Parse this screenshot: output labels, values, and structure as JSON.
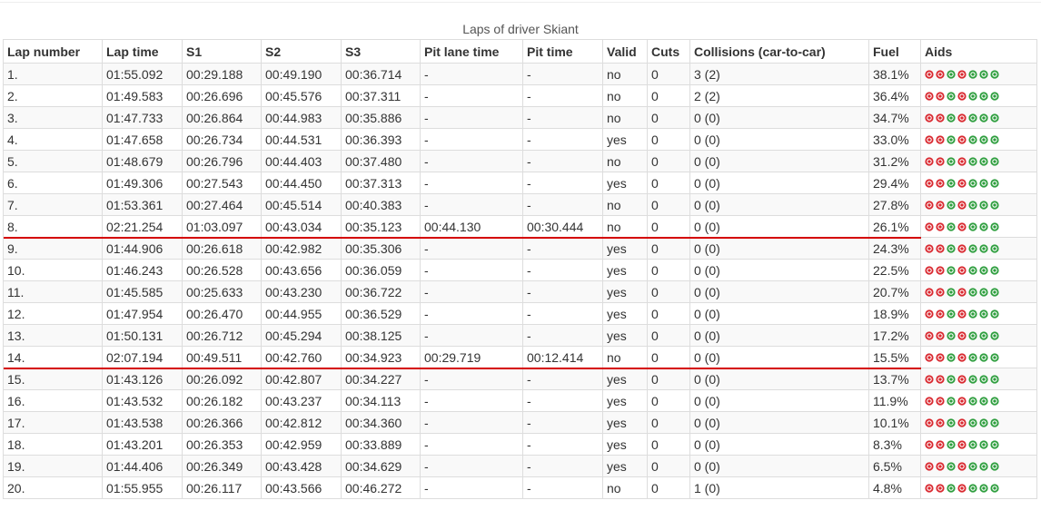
{
  "title": "Laps of driver Skiant",
  "columns": [
    "Lap number",
    "Lap time",
    "S1",
    "S2",
    "S3",
    "Pit lane time",
    "Pit time",
    "Valid",
    "Cuts",
    "Collisions (car-to-car)",
    "Fuel",
    "Aids"
  ],
  "aid_icons": [
    {
      "name": "abs-aid-icon",
      "color": "#d9282f"
    },
    {
      "name": "traction-control-aid-icon",
      "color": "#d9282f"
    },
    {
      "name": "stability-control-aid-icon",
      "color": "#2e9e3e"
    },
    {
      "name": "auto-clutch-aid-icon",
      "color": "#d9282f"
    },
    {
      "name": "auto-gear-aid-icon",
      "color": "#2e9e3e"
    },
    {
      "name": "ideal-line-aid-icon",
      "color": "#2e9e3e"
    },
    {
      "name": "auto-blip-aid-icon",
      "color": "#2e9e3e"
    }
  ],
  "rows": [
    [
      "1.",
      "01:55.092",
      "00:29.188",
      "00:49.190",
      "00:36.714",
      "-",
      "-",
      "no",
      "0",
      "3 (2)",
      "38.1%"
    ],
    [
      "2.",
      "01:49.583",
      "00:26.696",
      "00:45.576",
      "00:37.311",
      "-",
      "-",
      "no",
      "0",
      "2 (2)",
      "36.4%"
    ],
    [
      "3.",
      "01:47.733",
      "00:26.864",
      "00:44.983",
      "00:35.886",
      "-",
      "-",
      "no",
      "0",
      "0 (0)",
      "34.7%"
    ],
    [
      "4.",
      "01:47.658",
      "00:26.734",
      "00:44.531",
      "00:36.393",
      "-",
      "-",
      "yes",
      "0",
      "0 (0)",
      "33.0%"
    ],
    [
      "5.",
      "01:48.679",
      "00:26.796",
      "00:44.403",
      "00:37.480",
      "-",
      "-",
      "no",
      "0",
      "0 (0)",
      "31.2%"
    ],
    [
      "6.",
      "01:49.306",
      "00:27.543",
      "00:44.450",
      "00:37.313",
      "-",
      "-",
      "yes",
      "0",
      "0 (0)",
      "29.4%"
    ],
    [
      "7.",
      "01:53.361",
      "00:27.464",
      "00:45.514",
      "00:40.383",
      "-",
      "-",
      "no",
      "0",
      "0 (0)",
      "27.8%"
    ],
    [
      "8.",
      "02:21.254",
      "01:03.097",
      "00:43.034",
      "00:35.123",
      "00:44.130",
      "00:30.444",
      "no",
      "0",
      "0 (0)",
      "26.1%"
    ],
    [
      "9.",
      "01:44.906",
      "00:26.618",
      "00:42.982",
      "00:35.306",
      "-",
      "-",
      "yes",
      "0",
      "0 (0)",
      "24.3%"
    ],
    [
      "10.",
      "01:46.243",
      "00:26.528",
      "00:43.656",
      "00:36.059",
      "-",
      "-",
      "yes",
      "0",
      "0 (0)",
      "22.5%"
    ],
    [
      "11.",
      "01:45.585",
      "00:25.633",
      "00:43.230",
      "00:36.722",
      "-",
      "-",
      "yes",
      "0",
      "0 (0)",
      "20.7%"
    ],
    [
      "12.",
      "01:47.954",
      "00:26.470",
      "00:44.955",
      "00:36.529",
      "-",
      "-",
      "yes",
      "0",
      "0 (0)",
      "18.9%"
    ],
    [
      "13.",
      "01:50.131",
      "00:26.712",
      "00:45.294",
      "00:38.125",
      "-",
      "-",
      "yes",
      "0",
      "0 (0)",
      "17.2%"
    ],
    [
      "14.",
      "02:07.194",
      "00:49.511",
      "00:42.760",
      "00:34.923",
      "00:29.719",
      "00:12.414",
      "no",
      "0",
      "0 (0)",
      "15.5%"
    ],
    [
      "15.",
      "01:43.126",
      "00:26.092",
      "00:42.807",
      "00:34.227",
      "-",
      "-",
      "yes",
      "0",
      "0 (0)",
      "13.7%"
    ],
    [
      "16.",
      "01:43.532",
      "00:26.182",
      "00:43.237",
      "00:34.113",
      "-",
      "-",
      "yes",
      "0",
      "0 (0)",
      "11.9%"
    ],
    [
      "17.",
      "01:43.538",
      "00:26.366",
      "00:42.812",
      "00:34.360",
      "-",
      "-",
      "yes",
      "0",
      "0 (0)",
      "10.1%"
    ],
    [
      "18.",
      "01:43.201",
      "00:26.353",
      "00:42.959",
      "00:33.889",
      "-",
      "-",
      "yes",
      "0",
      "0 (0)",
      "8.3%"
    ],
    [
      "19.",
      "01:44.406",
      "00:26.349",
      "00:43.428",
      "00:34.629",
      "-",
      "-",
      "yes",
      "0",
      "0 (0)",
      "6.5%"
    ],
    [
      "20.",
      "01:55.955",
      "00:26.117",
      "00:43.566",
      "00:46.272",
      "-",
      "-",
      "no",
      "0",
      "1 (0)",
      "4.8%"
    ]
  ],
  "pit_marker": {
    "color": "#d40000",
    "rows": [
      "8.",
      "14."
    ]
  }
}
